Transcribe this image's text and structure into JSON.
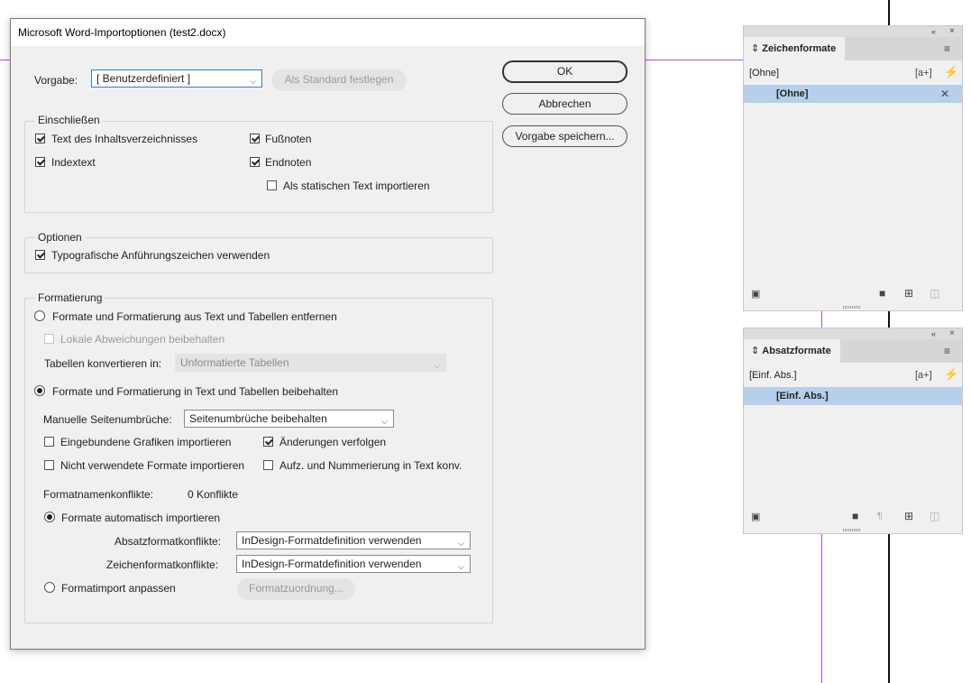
{
  "dialog": {
    "title": "Microsoft Word-Importoptionen (test2.docx)",
    "preset_label": "Vorgabe:",
    "preset_value": "[ Benutzerdefiniert ]",
    "set_default_button": "Als Standard festlegen",
    "ok_button": "OK",
    "cancel_button": "Abbrechen",
    "save_preset_button": "Vorgabe speichern...",
    "include": {
      "title": "Einschließen",
      "toc_text": "Text des Inhaltsverzeichnisses",
      "index_text": "Indextext",
      "footnotes": "Fußnoten",
      "endnotes": "Endnoten",
      "static_text": "Als statischen Text importieren"
    },
    "options": {
      "title": "Optionen",
      "typo_quotes": "Typografische Anführungszeichen verwenden"
    },
    "formatting": {
      "title": "Formatierung",
      "remove_styles": "Formate und Formatierung aus Text und Tabellen entfernen",
      "keep_local_overrides": "Lokale Abweichungen beibehalten",
      "convert_tables_label": "Tabellen konvertieren in:",
      "convert_tables_value": "Unformatierte Tabellen",
      "preserve_styles": "Formate und Formatierung in Text und Tabellen beibehalten",
      "manual_breaks_label": "Manuelle Seitenumbrüche:",
      "manual_breaks_value": "Seitenumbrüche beibehalten",
      "import_inline_graphics": "Eingebundene Grafiken importieren",
      "track_changes": "Änderungen verfolgen",
      "import_unused_styles": "Nicht verwendete Formate importieren",
      "convert_bullets": "Aufz. und Nummerierung in Text konv.",
      "conflicts_label": "Formatnamenkonflikte:",
      "conflicts_value": "0 Konflikte",
      "auto_import": "Formate automatisch importieren",
      "para_conflicts_label": "Absatzformatkonflikte:",
      "para_conflicts_value": "InDesign-Formatdefinition verwenden",
      "char_conflicts_label": "Zeichenformatkonflikte:",
      "char_conflicts_value": "InDesign-Formatdefinition verwenden",
      "customize_import": "Formatimport anpassen",
      "style_mapping_button": "Formatzuordnung..."
    }
  },
  "char_panel": {
    "tab": "Zeichenformate",
    "current": "[Ohne]",
    "add_icon_text": "[a+]",
    "row": "[Ohne]"
  },
  "para_panel": {
    "tab": "Absatzformate",
    "current": "[Einf. Abs.]",
    "add_icon_text": "[a+]",
    "row": "[Einf. Abs.]"
  },
  "colors": {
    "guide": "#b04bd4",
    "selection": "#b6cfea",
    "focus_border": "#2a7fd4"
  }
}
